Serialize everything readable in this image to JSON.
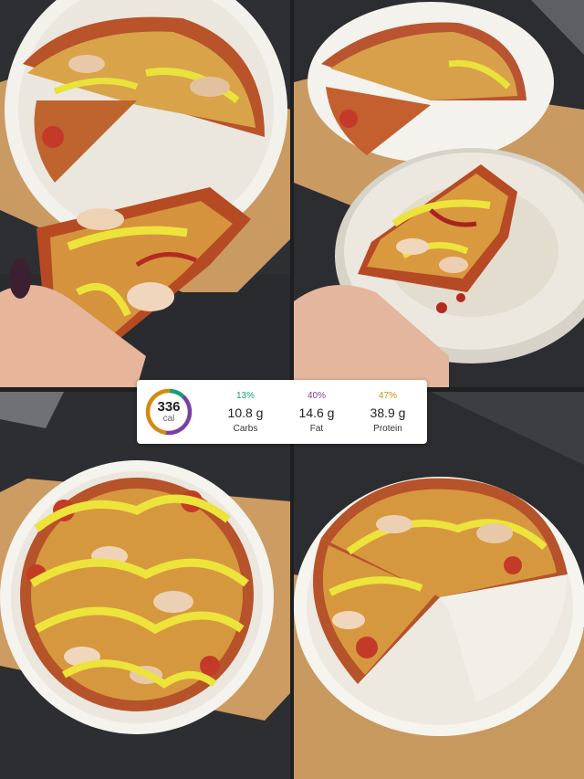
{
  "photos": [
    {
      "subject": "pizza-held-slice"
    },
    {
      "subject": "pizza-slice-on-plate"
    },
    {
      "subject": "whole-pizza"
    },
    {
      "subject": "pizza-missing-slice"
    }
  ],
  "nutrition": {
    "calories": "336",
    "calories_unit": "cal",
    "ring_fractions": {
      "carbs": 0.13,
      "fat": 0.4,
      "protein": 0.47
    },
    "carbs": {
      "percent": "13%",
      "grams": "10.8 g",
      "label": "Carbs",
      "color": "#1a9e78"
    },
    "fat": {
      "percent": "40%",
      "grams": "14.6 g",
      "label": "Fat",
      "color": "#7b3fa3"
    },
    "protein": {
      "percent": "47%",
      "grams": "38.9 g",
      "label": "Protein",
      "color": "#d48a12"
    }
  }
}
